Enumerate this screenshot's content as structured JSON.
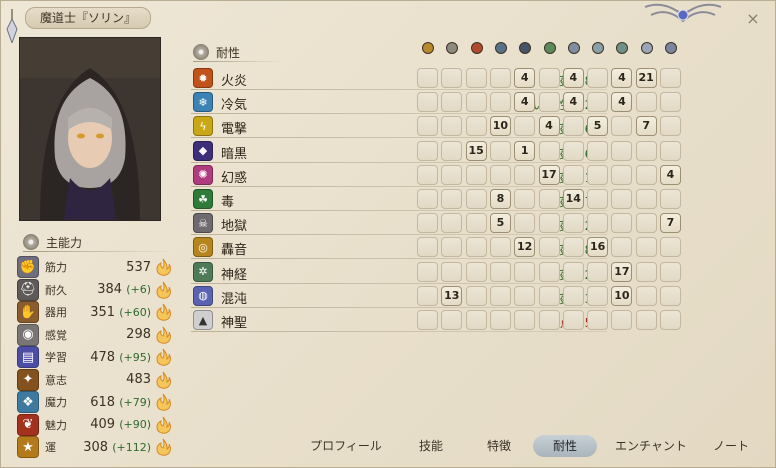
{
  "window": {
    "title": "魔道士『ソリン』",
    "close_label": "×"
  },
  "stats_header": "主能力",
  "stats": [
    {
      "label": "筋力",
      "value": "537",
      "bonus": "",
      "icon": "fist-icon",
      "color": "#6e6e7c"
    },
    {
      "label": "耐久",
      "value": "384",
      "bonus": "(+6)",
      "icon": "helmet-icon",
      "color": "#5e5a58"
    },
    {
      "label": "器用",
      "value": "351",
      "bonus": "(+60)",
      "icon": "hand-icon",
      "color": "#8a5d2e"
    },
    {
      "label": "感覚",
      "value": "298",
      "bonus": "",
      "icon": "eye-icon",
      "color": "#7a7575"
    },
    {
      "label": "学習",
      "value": "478",
      "bonus": "(+95)",
      "icon": "book-icon",
      "color": "#4c4ea6"
    },
    {
      "label": "意志",
      "value": "483",
      "bonus": "",
      "icon": "willpower-icon",
      "color": "#84521e"
    },
    {
      "label": "魔力",
      "value": "618",
      "bonus": "(+79)",
      "icon": "magic-icon",
      "color": "#3e7aa0"
    },
    {
      "label": "魅力",
      "value": "409",
      "bonus": "(+90)",
      "icon": "charm-icon",
      "color": "#a4311e"
    },
    {
      "label": "運",
      "value": "308",
      "bonus": "(+112)",
      "icon": "luck-icon",
      "color": "#b27a1b"
    }
  ],
  "resist_header": "耐性",
  "equip_icons": [
    "staff-icon",
    "wand-icon",
    "hat-icon",
    "armor-icon",
    "cloak-icon",
    "gauntlet-icon",
    "weapon-icon",
    "boot-icon",
    "amulet-icon",
    "ring-icon",
    "gem-icon"
  ],
  "resists": [
    {
      "name": "火炎",
      "level": "免疫 (28)",
      "level_color": "#2e6b2a",
      "icon": "fire-icon",
      "color": "#c2521a",
      "cells": [
        "",
        "",
        "",
        "",
        "4",
        "",
        "4",
        "",
        "4",
        "21",
        ""
      ]
    },
    {
      "name": "冷気",
      "level": "強い耐性 (12)",
      "level_color": "#2e6b2a",
      "icon": "cold-icon",
      "color": "#3b82b5",
      "cells": [
        "",
        "",
        "",
        "",
        "4",
        "",
        "4",
        "",
        "4",
        "",
        ""
      ]
    },
    {
      "name": "電撃",
      "level": "免疫 (26)",
      "level_color": "#2e6b2a",
      "icon": "lightning-icon",
      "color": "#c9a716",
      "cells": [
        "",
        "",
        "",
        "10",
        "",
        "4",
        "",
        "5",
        "",
        "7",
        ""
      ]
    },
    {
      "name": "暗黒",
      "level": "免疫 (26)",
      "level_color": "#2e6b2a",
      "icon": "darkness-icon",
      "color": "#3e2f7a",
      "cells": [
        "",
        "",
        "15",
        "",
        "1",
        "",
        "",
        "",
        "",
        "",
        ""
      ]
    },
    {
      "name": "幻惑",
      "level": "免疫 (21)",
      "level_color": "#2e6b2a",
      "icon": "illusion-icon",
      "color": "#b03b7e",
      "cells": [
        "",
        "",
        "",
        "",
        "",
        "17",
        "",
        "",
        "",
        "",
        "4"
      ]
    },
    {
      "name": "毒",
      "level": "免疫 (27)",
      "level_color": "#2e6b2a",
      "icon": "poison-icon",
      "color": "#2f7b3a",
      "cells": [
        "",
        "",
        "",
        "8",
        "",
        "",
        "14",
        "",
        "",
        "",
        ""
      ]
    },
    {
      "name": "地獄",
      "level": "免疫 (22)",
      "level_color": "#2e6b2a",
      "icon": "nether-icon",
      "color": "#6f6a70",
      "cells": [
        "",
        "",
        "",
        "5",
        "",
        "",
        "",
        "",
        "",
        "",
        "7"
      ]
    },
    {
      "name": "轟音",
      "level": "免疫 (28)",
      "level_color": "#2e6b2a",
      "icon": "sound-icon",
      "color": "#b7851d",
      "cells": [
        "",
        "",
        "",
        "",
        "12",
        "",
        "",
        "16",
        "",
        "",
        ""
      ]
    },
    {
      "name": "神経",
      "level": "免疫 (22)",
      "level_color": "#2e6b2a",
      "icon": "nerve-icon",
      "color": "#4f7c58",
      "cells": [
        "",
        "",
        "",
        "",
        "",
        "",
        "",
        "",
        "17",
        "",
        ""
      ]
    },
    {
      "name": "混沌",
      "level": "免疫 (23)",
      "level_color": "#2e6b2a",
      "icon": "chaos-icon",
      "color": "#5a62b2",
      "cells": [
        "",
        "13",
        "",
        "",
        "",
        "",
        "",
        "",
        "10",
        "",
        ""
      ]
    },
    {
      "name": "神聖",
      "level": "弱点 (-5)",
      "level_color": "#a3231a",
      "icon": "holy-icon",
      "color": "#cfcfcf",
      "cells": [
        "",
        "",
        "",
        "",
        "",
        "",
        "",
        "",
        "",
        "",
        ""
      ]
    }
  ],
  "tabs": [
    {
      "label": "プロフィール",
      "active": false
    },
    {
      "label": "技能",
      "active": false
    },
    {
      "label": "特徴",
      "active": false
    },
    {
      "label": "耐性",
      "active": true
    },
    {
      "label": "エンチャント",
      "active": false
    },
    {
      "label": "ノート",
      "active": false
    }
  ]
}
